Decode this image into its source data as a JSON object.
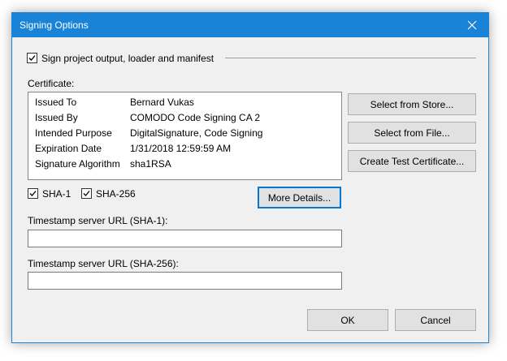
{
  "window": {
    "title": "Signing Options"
  },
  "sign": {
    "checkbox_label": "Sign project output, loader and manifest",
    "checked": true
  },
  "certificate": {
    "label": "Certificate:",
    "rows": [
      {
        "key": "Issued To",
        "value": "Bernard Vukas"
      },
      {
        "key": "Issued By",
        "value": "COMODO Code Signing CA 2"
      },
      {
        "key": "Intended Purpose",
        "value": "DigitalSignature, Code Signing"
      },
      {
        "key": "Expiration Date",
        "value": "1/31/2018 12:59:59 AM"
      },
      {
        "key": "Signature Algorithm",
        "value": "sha1RSA"
      }
    ]
  },
  "buttons": {
    "select_from_store": "Select from Store...",
    "select_from_file": "Select from File...",
    "create_test_certificate": "Create Test Certificate...",
    "more_details": "More Details...",
    "ok": "OK",
    "cancel": "Cancel"
  },
  "hash": {
    "sha1_label": "SHA-1",
    "sha1_checked": true,
    "sha256_label": "SHA-256",
    "sha256_checked": true
  },
  "timestamp": {
    "sha1_label": "Timestamp server URL (SHA-1):",
    "sha1_value": "",
    "sha256_label": "Timestamp server URL (SHA-256):",
    "sha256_value": ""
  },
  "colors": {
    "accent": "#1883d7",
    "dialog_bg": "#f0f0f0",
    "button_bg": "#e1e1e1",
    "default_button_border": "#0078d7"
  },
  "icons": {
    "close": "close-icon",
    "check": "checkmark-icon"
  }
}
